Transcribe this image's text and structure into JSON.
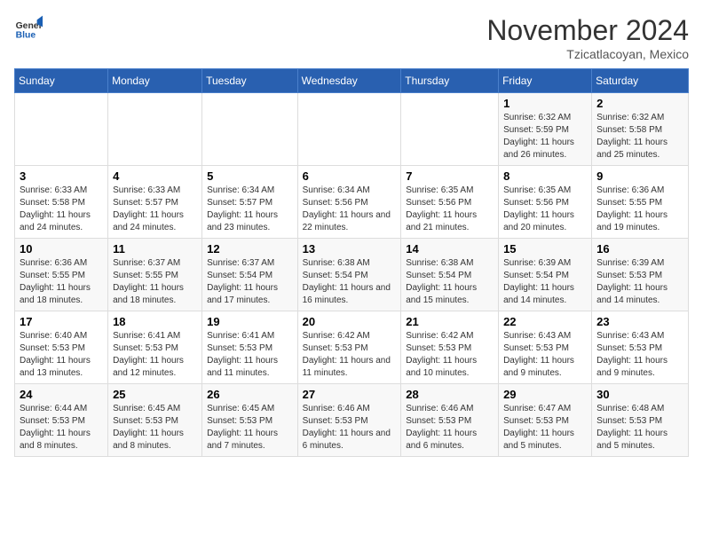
{
  "header": {
    "logo_general": "General",
    "logo_blue": "Blue",
    "month_title": "November 2024",
    "location": "Tzicatlacoyan, Mexico"
  },
  "days_of_week": [
    "Sunday",
    "Monday",
    "Tuesday",
    "Wednesday",
    "Thursday",
    "Friday",
    "Saturday"
  ],
  "weeks": [
    [
      {
        "day": "",
        "info": ""
      },
      {
        "day": "",
        "info": ""
      },
      {
        "day": "",
        "info": ""
      },
      {
        "day": "",
        "info": ""
      },
      {
        "day": "",
        "info": ""
      },
      {
        "day": "1",
        "info": "Sunrise: 6:32 AM\nSunset: 5:59 PM\nDaylight: 11 hours and 26 minutes."
      },
      {
        "day": "2",
        "info": "Sunrise: 6:32 AM\nSunset: 5:58 PM\nDaylight: 11 hours and 25 minutes."
      }
    ],
    [
      {
        "day": "3",
        "info": "Sunrise: 6:33 AM\nSunset: 5:58 PM\nDaylight: 11 hours and 24 minutes."
      },
      {
        "day": "4",
        "info": "Sunrise: 6:33 AM\nSunset: 5:57 PM\nDaylight: 11 hours and 24 minutes."
      },
      {
        "day": "5",
        "info": "Sunrise: 6:34 AM\nSunset: 5:57 PM\nDaylight: 11 hours and 23 minutes."
      },
      {
        "day": "6",
        "info": "Sunrise: 6:34 AM\nSunset: 5:56 PM\nDaylight: 11 hours and 22 minutes."
      },
      {
        "day": "7",
        "info": "Sunrise: 6:35 AM\nSunset: 5:56 PM\nDaylight: 11 hours and 21 minutes."
      },
      {
        "day": "8",
        "info": "Sunrise: 6:35 AM\nSunset: 5:56 PM\nDaylight: 11 hours and 20 minutes."
      },
      {
        "day": "9",
        "info": "Sunrise: 6:36 AM\nSunset: 5:55 PM\nDaylight: 11 hours and 19 minutes."
      }
    ],
    [
      {
        "day": "10",
        "info": "Sunrise: 6:36 AM\nSunset: 5:55 PM\nDaylight: 11 hours and 18 minutes."
      },
      {
        "day": "11",
        "info": "Sunrise: 6:37 AM\nSunset: 5:55 PM\nDaylight: 11 hours and 18 minutes."
      },
      {
        "day": "12",
        "info": "Sunrise: 6:37 AM\nSunset: 5:54 PM\nDaylight: 11 hours and 17 minutes."
      },
      {
        "day": "13",
        "info": "Sunrise: 6:38 AM\nSunset: 5:54 PM\nDaylight: 11 hours and 16 minutes."
      },
      {
        "day": "14",
        "info": "Sunrise: 6:38 AM\nSunset: 5:54 PM\nDaylight: 11 hours and 15 minutes."
      },
      {
        "day": "15",
        "info": "Sunrise: 6:39 AM\nSunset: 5:54 PM\nDaylight: 11 hours and 14 minutes."
      },
      {
        "day": "16",
        "info": "Sunrise: 6:39 AM\nSunset: 5:53 PM\nDaylight: 11 hours and 14 minutes."
      }
    ],
    [
      {
        "day": "17",
        "info": "Sunrise: 6:40 AM\nSunset: 5:53 PM\nDaylight: 11 hours and 13 minutes."
      },
      {
        "day": "18",
        "info": "Sunrise: 6:41 AM\nSunset: 5:53 PM\nDaylight: 11 hours and 12 minutes."
      },
      {
        "day": "19",
        "info": "Sunrise: 6:41 AM\nSunset: 5:53 PM\nDaylight: 11 hours and 11 minutes."
      },
      {
        "day": "20",
        "info": "Sunrise: 6:42 AM\nSunset: 5:53 PM\nDaylight: 11 hours and 11 minutes."
      },
      {
        "day": "21",
        "info": "Sunrise: 6:42 AM\nSunset: 5:53 PM\nDaylight: 11 hours and 10 minutes."
      },
      {
        "day": "22",
        "info": "Sunrise: 6:43 AM\nSunset: 5:53 PM\nDaylight: 11 hours and 9 minutes."
      },
      {
        "day": "23",
        "info": "Sunrise: 6:43 AM\nSunset: 5:53 PM\nDaylight: 11 hours and 9 minutes."
      }
    ],
    [
      {
        "day": "24",
        "info": "Sunrise: 6:44 AM\nSunset: 5:53 PM\nDaylight: 11 hours and 8 minutes."
      },
      {
        "day": "25",
        "info": "Sunrise: 6:45 AM\nSunset: 5:53 PM\nDaylight: 11 hours and 8 minutes."
      },
      {
        "day": "26",
        "info": "Sunrise: 6:45 AM\nSunset: 5:53 PM\nDaylight: 11 hours and 7 minutes."
      },
      {
        "day": "27",
        "info": "Sunrise: 6:46 AM\nSunset: 5:53 PM\nDaylight: 11 hours and 6 minutes."
      },
      {
        "day": "28",
        "info": "Sunrise: 6:46 AM\nSunset: 5:53 PM\nDaylight: 11 hours and 6 minutes."
      },
      {
        "day": "29",
        "info": "Sunrise: 6:47 AM\nSunset: 5:53 PM\nDaylight: 11 hours and 5 minutes."
      },
      {
        "day": "30",
        "info": "Sunrise: 6:48 AM\nSunset: 5:53 PM\nDaylight: 11 hours and 5 minutes."
      }
    ]
  ]
}
